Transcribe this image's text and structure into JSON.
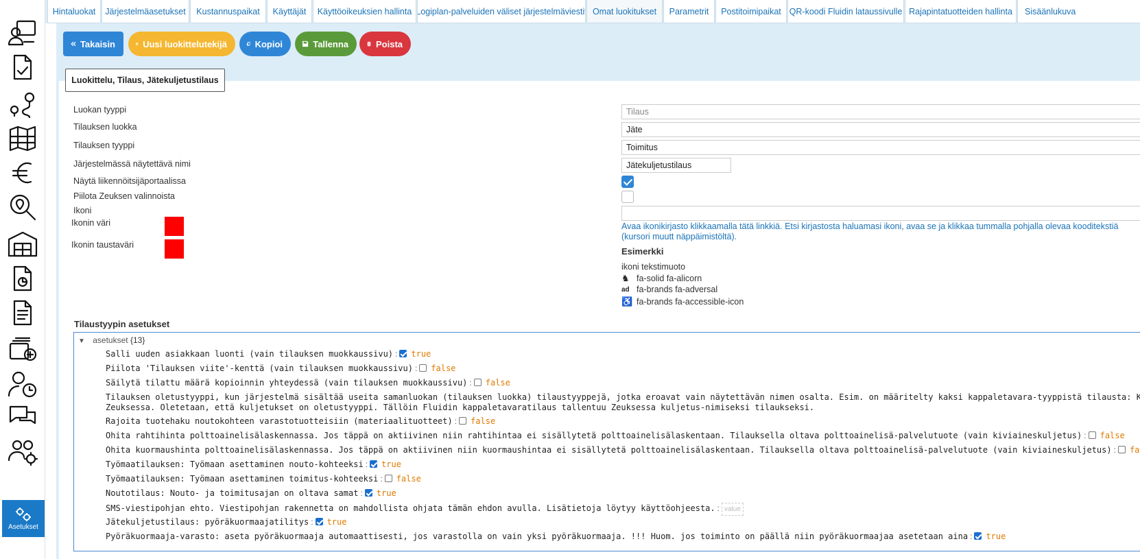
{
  "tabs": [
    {
      "label": "Hintaluokat"
    },
    {
      "label": "Järjestelmäasetukset"
    },
    {
      "label": "Kustannuspaikat"
    },
    {
      "label": "Käyttäjät"
    },
    {
      "label": "Käyttöoikeuksien hallinta"
    },
    {
      "label": "Logiplan-palveluiden väliset järjestelmäviestit"
    },
    {
      "label": "Omat luokitukset"
    },
    {
      "label": "Parametrit"
    },
    {
      "label": "Postitoimipaikat"
    },
    {
      "label": "QR-koodi Fluidin lataussivulle"
    },
    {
      "label": "Rajapintatuotteiden hallinta"
    },
    {
      "label": "Sisäänlukuva"
    }
  ],
  "active_tab": "Omat luokitukset",
  "sidebar": {
    "icons": [
      "customer-screen-icon",
      "order-checklist-icon",
      "route-icon",
      "map-icon",
      "euro-icon",
      "search-location-icon",
      "warehouse-icon",
      "report-icon",
      "invoice-icon",
      "add-order-icon",
      "user-clock-icon",
      "chat-icon",
      "users-settings-icon"
    ],
    "active_label": "Asetukset"
  },
  "toolbar": {
    "back": "Takaisin",
    "new": "Uusi luokittelutekijä",
    "copy": "Kopioi",
    "save": "Tallenna",
    "delete": "Poista"
  },
  "breadcrumb": "Luokittelu, Tilaus, Jätekuljetustilaus",
  "form": {
    "class_type_label": "Luokan tyyppi",
    "class_type_value": "Tilaus",
    "order_class_label": "Tilauksen luokka",
    "order_class_value": "Jäte",
    "order_type_label": "Tilauksen tyyppi",
    "order_type_value": "Toimitus",
    "display_name_label": "Järjestelmässä näytettävä nimi",
    "display_name_value": "Jätekuljetustilaus",
    "show_portal_label": "Näytä liikennöitsijäportaalissa",
    "show_portal_checked": true,
    "hide_zeus_label": "Piilota Zeuksen valinnoista",
    "hide_zeus_checked": false,
    "icon_label": "Ikoni",
    "icon_color_label": "Ikonin väri",
    "icon_color": "#ff0000",
    "icon_bg_label": "Ikonin taustaväri",
    "icon_bg": "#ff0000",
    "help_text": "Avaa ikonikirjasto klikkaamalla tätä linkkiä. Etsi kirjastosta haluamasi ikoni, avaa se ja klikkaa tummalla pohjalla olevaa koodi­tekstiä (kursori muutt näppäimistöltä).",
    "examples_title": "Esimerkki",
    "examples_caption": "ikoni tekstimuoto",
    "examples": [
      {
        "icon": "alicorn-icon",
        "glyph": "♞",
        "text": "fa-solid fa-alicorn"
      },
      {
        "icon": "adversal-icon",
        "glyph": "ad",
        "text": "fa-brands fa-adversal"
      },
      {
        "icon": "accessible-icon",
        "glyph": "♿",
        "text": "fa-brands fa-accessible-icon"
      }
    ]
  },
  "settings_section": {
    "title": "Tilaustyypin asetukset",
    "root_key": "asetukset",
    "root_count": "{13}",
    "rows": [
      {
        "text": "Salli uuden asiakkaan luonti (vain tilauksen muokkaussivu)",
        "type": "bool",
        "value": true,
        "value_text": "true"
      },
      {
        "text": "Piilota 'Tilauksen viite'-kenttä (vain tilauksen muokkaussivu)",
        "type": "bool",
        "value": false,
        "value_text": "false"
      },
      {
        "text": "Säilytä tilattu määrä kopioinnin yhteydessä (vain tilauksen muokkaussivu)",
        "type": "bool",
        "value": false,
        "value_text": "false"
      },
      {
        "text": "Tilauksen oletustyyppi, kun järjestelmä sisältää useita samanluokan (tilauksen luokka) tilaustyyppejä, jotka eroavat vain näytettävän nimen osalta. Esim. on määritelty kaksi kappaletavara-tyyppistä tilausta: Kuljetukse",
        "line2": "Zeuksessa. Oletetaan, että kuljetukset on oletustyyppi. Tällöin Fluidin kappaletavaratilaus tallentuu Zeuksessa kuljetus-nimiseksi tilaukseksi.",
        "type": "text"
      },
      {
        "text": "Rajoita tuotehaku noutokohteen varastotuotteisiin (materiaalituotteet)",
        "type": "bool",
        "value": false,
        "value_text": "false"
      },
      {
        "text": "Ohita rahtihinta polttoainelisälaskennassa. Jos täppä on aktiivinen niin rahtihintaa ei sisällytetä polttoainelisälaskentaan. Tilauksella oltava polttoainelisä-palvelutuote (vain kiviaineskuljetus)",
        "type": "bool",
        "value": false,
        "value_text": "false"
      },
      {
        "text": "Ohita kuormaushinta polttoainelisälaskennassa. Jos täppä on aktiivinen niin kuormaushintaa ei sisällytetä polttoainelisälaskentaan. Tilauksella oltava polttoainelisä-palvelutuote (vain kiviaineskuljetus)",
        "type": "bool",
        "value": false,
        "value_text": "false"
      },
      {
        "text": "Työmaatilauksen: Työmaan asettaminen nouto-kohteeksi",
        "type": "bool",
        "value": true,
        "value_text": "true"
      },
      {
        "text": "Työmaatilauksen: Työmaan asettaminen toimitus-kohteeksi",
        "type": "bool",
        "value": false,
        "value_text": "false"
      },
      {
        "text": "Noutotilaus: Nouto- ja toimitusajan on oltava samat",
        "type": "bool",
        "value": true,
        "value_text": "true"
      },
      {
        "text": "SMS-viestipohjan ehto. Viestipohjan rakennetta on mahdollista ohjata tämän ehdon avulla. Lisätietoja löytyy käyttöohjeesta.",
        "type": "empty",
        "placeholder": "value"
      },
      {
        "text": "Jätekuljetustilaus: pyöräkuormaajatilitys",
        "type": "bool",
        "value": true,
        "value_text": "true"
      },
      {
        "text": "Pyöräkuormaaja-varasto: aseta pyöräkuormaaja automaattisesti, jos varastolla on vain yksi pyöräkuormaaja. !!! Huom. jos toiminto on päällä niin pyöräkuormaajaa asetetaan aina",
        "type": "bool",
        "value": true,
        "value_text": "true"
      }
    ]
  }
}
